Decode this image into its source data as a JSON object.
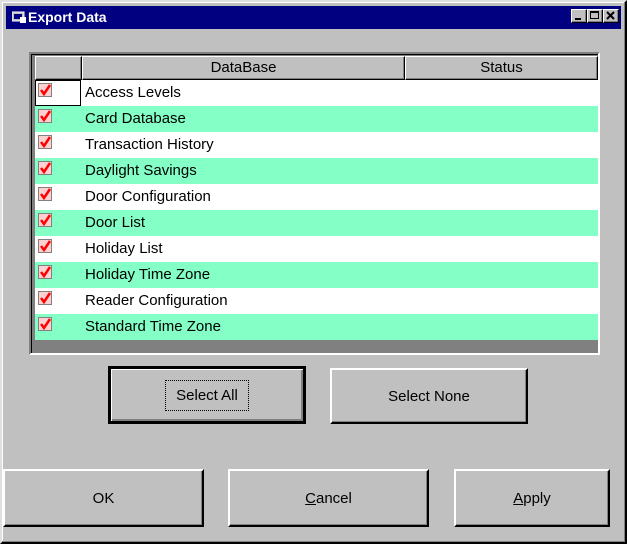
{
  "window": {
    "title": "Export Data",
    "controls": {
      "minimize": "minimize",
      "maximize": "maximize",
      "close": "close"
    }
  },
  "grid": {
    "columns": [
      "",
      "DataBase",
      "Status"
    ],
    "rows": [
      {
        "name": "Access Levels",
        "checked": true,
        "status": ""
      },
      {
        "name": "Card Database",
        "checked": true,
        "status": ""
      },
      {
        "name": "Transaction History",
        "checked": true,
        "status": ""
      },
      {
        "name": "Daylight Savings",
        "checked": true,
        "status": ""
      },
      {
        "name": "Door Configuration",
        "checked": true,
        "status": ""
      },
      {
        "name": "Door List",
        "checked": true,
        "status": ""
      },
      {
        "name": "Holiday List",
        "checked": true,
        "status": ""
      },
      {
        "name": "Holiday Time Zone",
        "checked": true,
        "status": ""
      },
      {
        "name": "Reader Configuration",
        "checked": true,
        "status": ""
      },
      {
        "name": "Standard Time Zone",
        "checked": true,
        "status": ""
      }
    ]
  },
  "buttons": {
    "select_all": "Select All",
    "select_none": "Select None",
    "ok": "OK",
    "cancel_mnemonic": "C",
    "cancel_rest": "ancel",
    "apply_mnemonic": "A",
    "apply_rest": "pply"
  },
  "colors": {
    "titlebar": "#000080",
    "row_alt": "#84ffc6",
    "face": "#c0c0c0"
  }
}
